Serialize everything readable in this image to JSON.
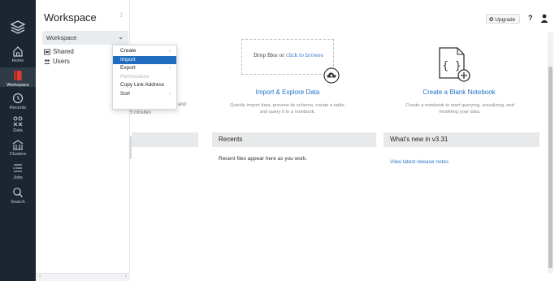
{
  "sidebar": {
    "items": [
      {
        "label": "Home",
        "icon": "home-icon"
      },
      {
        "label": "Workspace",
        "icon": "workspace-icon",
        "active": true
      },
      {
        "label": "Recents",
        "icon": "clock-icon"
      },
      {
        "label": "Data",
        "icon": "data-icon"
      },
      {
        "label": "Clusters",
        "icon": "clusters-icon"
      },
      {
        "label": "Jobs",
        "icon": "jobs-icon"
      },
      {
        "label": "Search",
        "icon": "search-icon"
      }
    ],
    "logo_icon": "layers-logo-icon",
    "active_color": "#e23b2e"
  },
  "workspace_panel": {
    "title": "Workspace",
    "selector": "Workspace",
    "rows": [
      {
        "label": "Shared",
        "icon": "shared-folder-icon"
      },
      {
        "label": "Users",
        "icon": "users-icon"
      }
    ]
  },
  "context_menu": {
    "items": [
      {
        "label": "Create",
        "submenu": true
      },
      {
        "label": "Import",
        "highlighted": true
      },
      {
        "label": "Export",
        "submenu": true
      },
      {
        "label": "Permissions",
        "disabled": true
      },
      {
        "label": "Copy Link Address"
      },
      {
        "label": "Sort",
        "submenu": true
      }
    ]
  },
  "topbar": {
    "upgrade_label": "Upgrade",
    "help_label": "?"
  },
  "upload": {
    "drop_text": "Drop files or ",
    "browse_link": "click to browse"
  },
  "cards": {
    "partial_left_1": "and",
    "partial_left_2": "5 minutes",
    "import": {
      "title": "Import & Explore Data",
      "desc_1": "Quickly import data, preview its schema, create a table,",
      "desc_2": "and query it in a notebook."
    },
    "notebook": {
      "title": "Create a Blank Notebook",
      "desc_1": "Create a notebook to start querying, visualizing, and",
      "desc_2": "modeling your data."
    }
  },
  "sections": {
    "recents": {
      "title": "Recents",
      "message": "Recent files appear here as you work."
    },
    "whats_new": {
      "title": "What's new in v3.31",
      "link": "View latest release notes"
    }
  },
  "colors": {
    "sidebar_bg": "#1b2631",
    "link_blue": "#1f72c7",
    "menu_highlight": "#1f6cc0"
  }
}
